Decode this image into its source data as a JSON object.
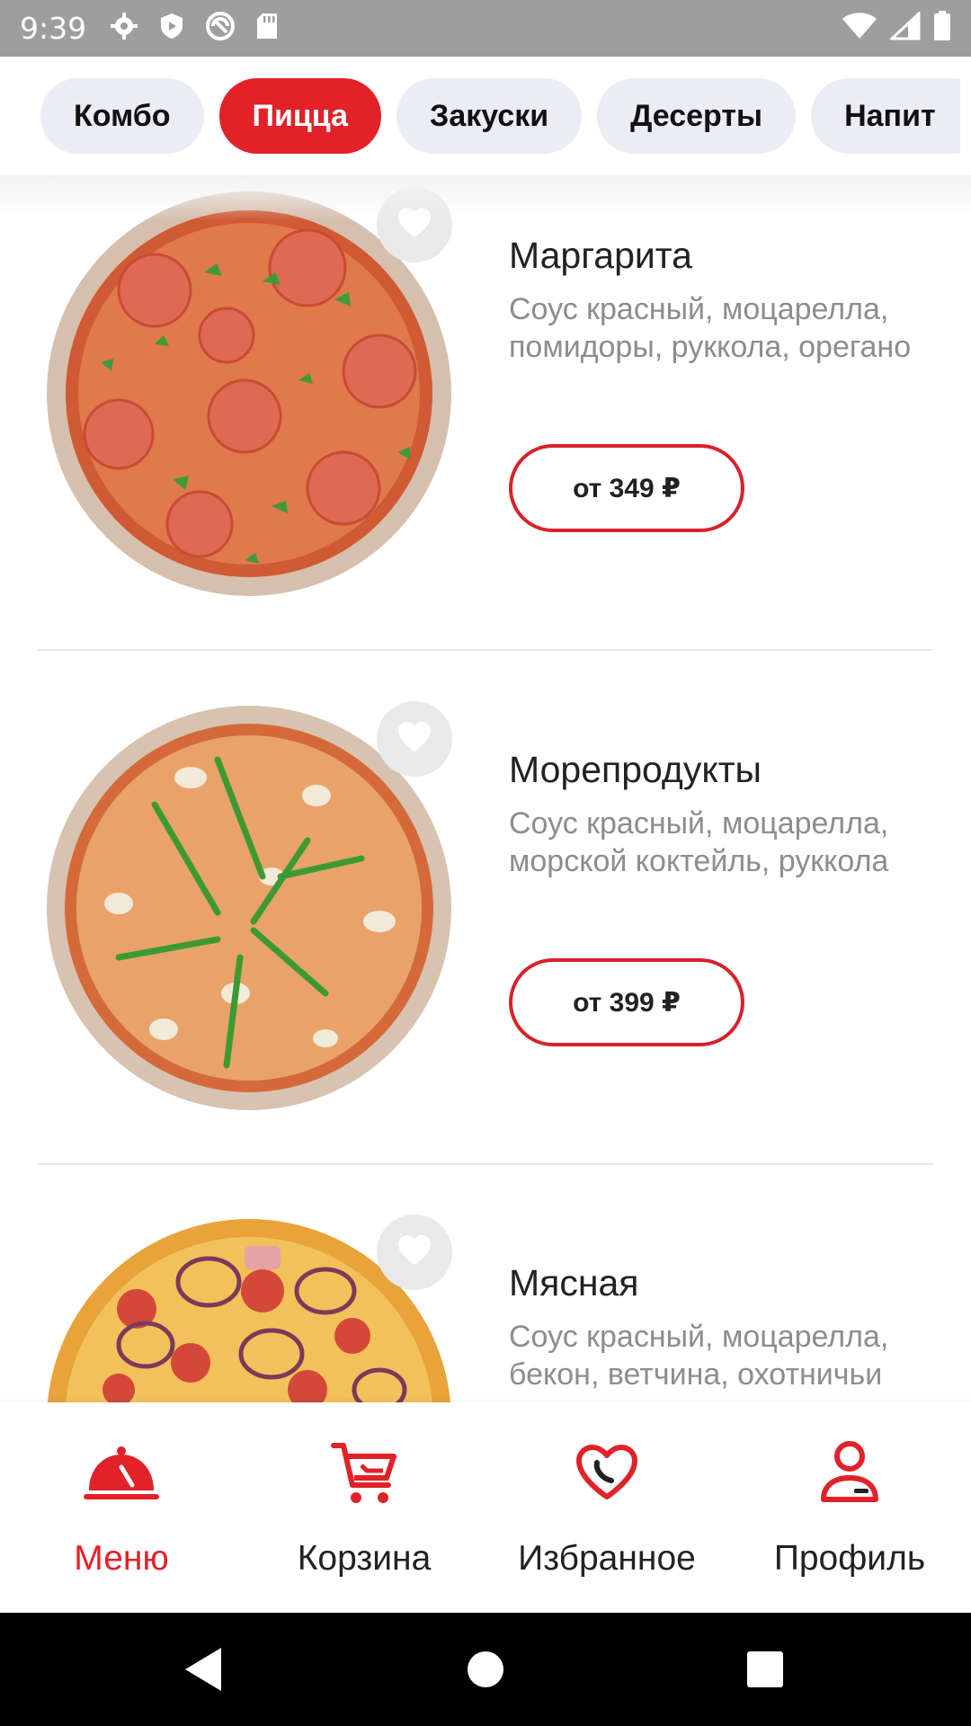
{
  "status_bar": {
    "time": "9:39",
    "icons": [
      "gear-icon",
      "shield-icon",
      "sync-icon",
      "sd-card-icon"
    ],
    "right_icons": [
      "wifi-icon",
      "signal-icon",
      "battery-icon"
    ]
  },
  "categories": {
    "items": [
      {
        "label": "Комбо",
        "active": false
      },
      {
        "label": "Пицца",
        "active": true
      },
      {
        "label": "Закуски",
        "active": false
      },
      {
        "label": "Десерты",
        "active": false
      },
      {
        "label": "Напит",
        "active": false
      }
    ]
  },
  "products": [
    {
      "name": "Маргарита",
      "description": "Соус красный, моцарелла, помидоры, руккола, орегано",
      "price": "от 349 ₽",
      "icon": "heart-icon"
    },
    {
      "name": "Морепродукты",
      "description": "Соус красный, моцарелла, морской коктейль, руккола",
      "price": "от 399 ₽",
      "icon": "heart-icon"
    },
    {
      "name": "Мясная",
      "description": "Соус красный, моцарелла, бекон, ветчина, охотничьи",
      "price": "",
      "icon": "heart-icon"
    }
  ],
  "bottom_nav": {
    "items": [
      {
        "label": "Меню",
        "icon": "cloche-icon",
        "active": true
      },
      {
        "label": "Корзина",
        "icon": "cart-icon",
        "active": false
      },
      {
        "label": "Избранное",
        "icon": "heart-phone-icon",
        "active": false
      },
      {
        "label": "Профиль",
        "icon": "profile-icon",
        "active": false
      }
    ]
  },
  "colors": {
    "accent": "#e22129",
    "chip_bg": "#ecedf4",
    "muted_text": "#8d8d8d",
    "status_bar": "#9e9e9e"
  }
}
